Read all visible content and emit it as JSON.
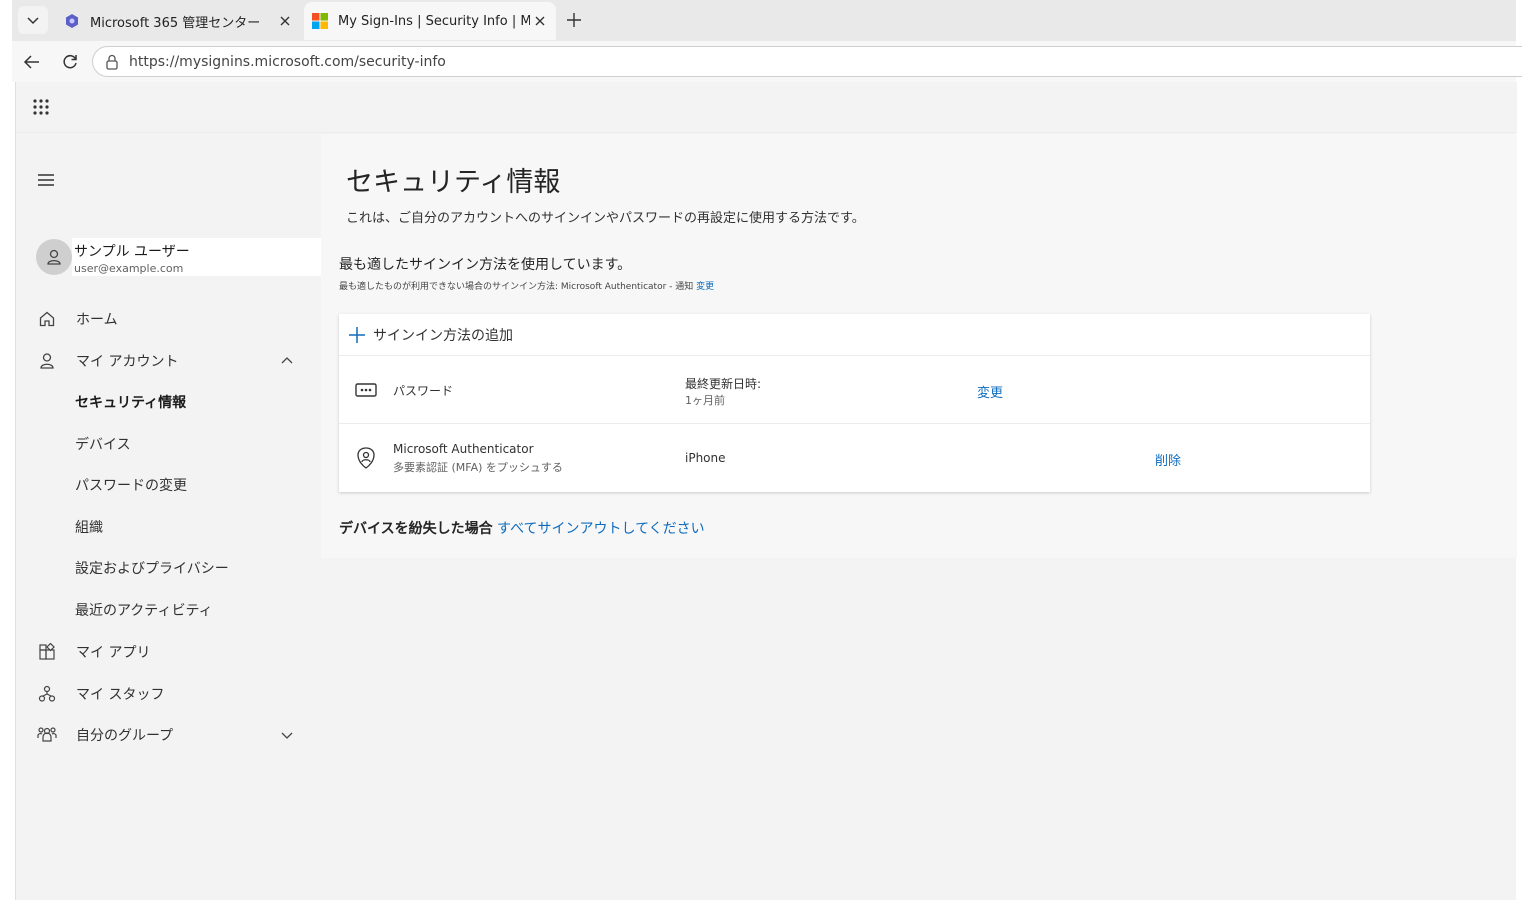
{
  "browser": {
    "tabs": [
      {
        "title": "Microsoft 365 管理センター",
        "active": false,
        "icon": "m365-admin-icon"
      },
      {
        "title": "My Sign-Ins | Security Info | Micros",
        "active": true,
        "icon": "microsoft-logo-icon"
      }
    ],
    "url": "https://mysignins.microsoft.com/security-info"
  },
  "user": {
    "name": "サンプル ユーザー",
    "email": "user@example.com"
  },
  "sidebar": {
    "items": [
      {
        "label": "ホーム",
        "icon": "home-icon"
      },
      {
        "label": "マイ アカウント",
        "icon": "person-icon"
      },
      {
        "label": "マイ アプリ",
        "icon": "apps-icon"
      },
      {
        "label": "マイ スタッフ",
        "icon": "org-icon"
      },
      {
        "label": "自分のグループ",
        "icon": "people-team-icon"
      }
    ],
    "sub_items": [
      {
        "label": "セキュリティ情報",
        "current": true
      },
      {
        "label": "デバイス",
        "current": false
      },
      {
        "label": "パスワードの変更",
        "current": false
      },
      {
        "label": "組織",
        "current": false
      },
      {
        "label": "設定およびプライバシー",
        "current": false
      },
      {
        "label": "最近のアクティビティ",
        "current": false
      }
    ]
  },
  "main": {
    "title": "セキュリティ情報",
    "description": "これは、ご自分のアカウントへのサインインやパスワードの再設定に使用する方法です。",
    "default_label": "最も適したサインイン方法を使用しています。",
    "default_sub": "最も適したものが利用できない場合のサインイン方法: Microsoft Authenticator - 通知",
    "default_change": "変更",
    "add_method": "サインイン方法の追加",
    "methods": [
      {
        "name": "パスワード",
        "detail": "",
        "col2_title": "最終更新日時:",
        "col2_value": "1ヶ月前",
        "action": "変更",
        "icon": "password-dots-icon"
      },
      {
        "name": "Microsoft Authenticator",
        "detail": "多要素認証 (MFA) をプッシュする",
        "col2_title": "iPhone",
        "col2_value": "",
        "action": "削除",
        "icon": "authenticator-icon"
      }
    ],
    "lost_device_label": "デバイスを紛失した場合",
    "lost_device_link": "すべてサインアウトしてください"
  },
  "colors": {
    "link": "#0f6cbd",
    "sidebar_bg": "#f3f3f3",
    "main_bg": "#f7f7f7"
  }
}
